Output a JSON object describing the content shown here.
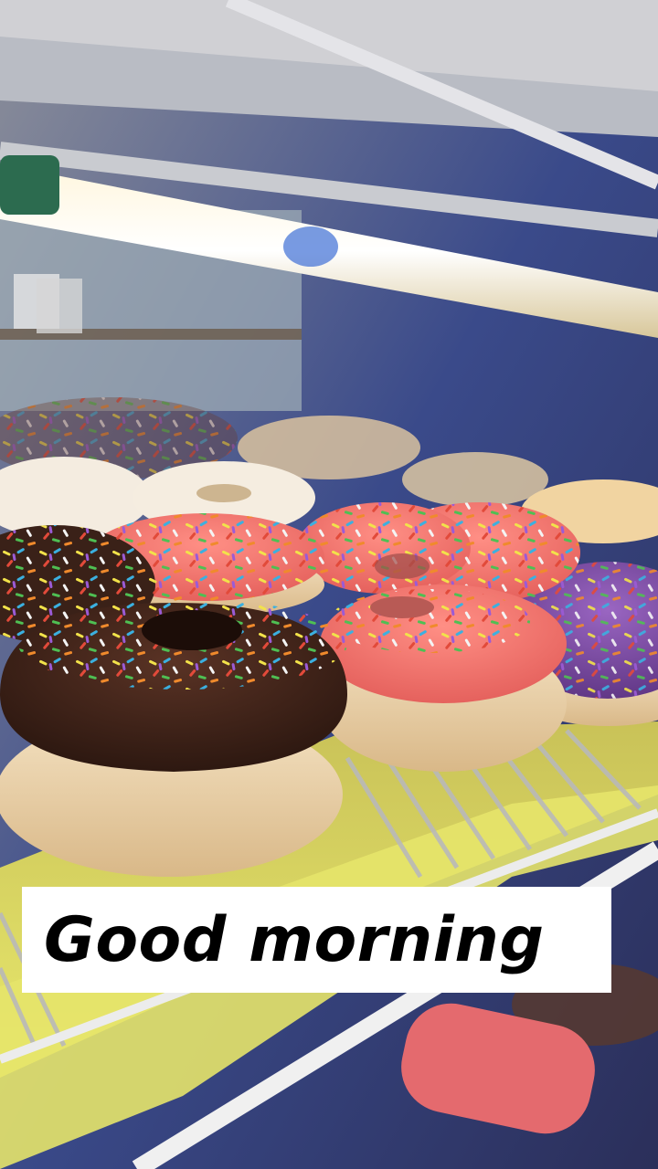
{
  "photo": {
    "subject": "donut-display-case"
  },
  "caption": {
    "text": "Good morning"
  },
  "colors": {
    "caption_background": "#ffffff",
    "caption_text": "#000000",
    "pink_glaze": "#ef6f6a",
    "chocolate_glaze": "#3a2118",
    "purple_glaze": "#7d4aa3",
    "rack": "#e6e86a"
  }
}
